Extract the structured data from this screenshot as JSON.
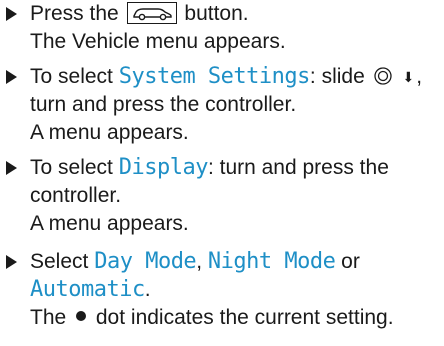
{
  "steps": [
    {
      "line1_a": "Press the",
      "line1_b": "button.",
      "result": "The Vehicle menu appears."
    },
    {
      "line1_a": "To select",
      "display_term": "System Settings",
      "line1_b": ": slide",
      "line1_c": ",",
      "line2": "turn and press the controller.",
      "result": "A menu appears."
    },
    {
      "line1_a": "To select",
      "display_term": "Display",
      "line1_b": ": turn and press the",
      "line2": "controller.",
      "result": "A menu appears."
    },
    {
      "line1_a": "Select",
      "term1": "Day Mode",
      "sep1": ",",
      "term2": "Night Mode",
      "sep2": "or",
      "term3": "Automatic",
      "end": ".",
      "result_a": "The",
      "result_b": "dot indicates the current setting."
    }
  ],
  "icons": {
    "vehicle_button": "car-icon",
    "controller": "controller-icon",
    "slide_down": "arrow-down-icon",
    "dot": "bullet-dot-icon"
  },
  "colors": {
    "display_text": "#1e8fc6",
    "body_text": "#1a1a1a"
  }
}
